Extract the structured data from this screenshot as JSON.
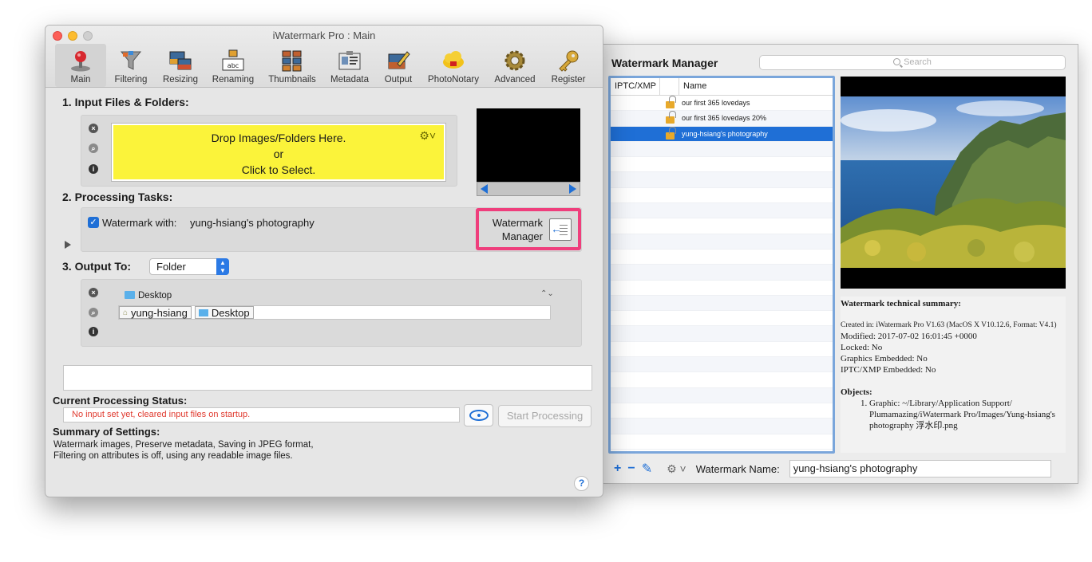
{
  "main_window": {
    "title": "iWatermark Pro : Main",
    "toolbar": [
      {
        "label": "Main",
        "icon": "joystick-icon",
        "active": true
      },
      {
        "label": "Filtering",
        "icon": "funnel-icon"
      },
      {
        "label": "Resizing",
        "icon": "resize-photos-icon"
      },
      {
        "label": "Renaming",
        "icon": "rename-abc-icon"
      },
      {
        "label": "Thumbnails",
        "icon": "thumbnails-icon"
      },
      {
        "label": "Metadata",
        "icon": "id-card-icon"
      },
      {
        "label": "Output",
        "icon": "output-pen-icon"
      },
      {
        "label": "PhotoNotary",
        "icon": "cloud-notary-icon"
      },
      {
        "label": "Advanced",
        "icon": "gear-icon"
      },
      {
        "label": "Register",
        "icon": "key-icon"
      }
    ],
    "input": {
      "title": "1. Input Files & Folders:",
      "drop_line1": "Drop Images/Folders Here.",
      "drop_line2": "or",
      "drop_line3": "Click to Select."
    },
    "tasks": {
      "title": "2. Processing Tasks:",
      "watermark_with_label": "Watermark with:",
      "watermark_with_checked": true,
      "watermark_value": "yung-hsiang's photography",
      "manager_line1": "Watermark",
      "manager_line2": "Manager"
    },
    "output": {
      "title": "3. Output To:",
      "selected": "Folder",
      "folder_name": "Desktop",
      "path": [
        "yung-hsiang",
        "Desktop"
      ]
    },
    "status": {
      "title": "Current Processing Status:",
      "message": "No input set yet, cleared input files on startup.",
      "start_button": "Start Processing"
    },
    "summary": {
      "title": "Summary of Settings:",
      "line1": "Watermark images, Preserve metadata, Saving in JPEG format,",
      "line2": "Filtering on attributes is off, using any readable image files."
    },
    "help_label": "?"
  },
  "watermark_manager": {
    "title": "Watermark Manager",
    "search_placeholder": "Search",
    "columns": [
      "IPTC/XMP",
      "Name"
    ],
    "rows": [
      {
        "name": "our first 365 lovedays",
        "selected": false
      },
      {
        "name": "our first 365 lovedays 20%",
        "selected": false
      },
      {
        "name": "yung-hsiang's photography",
        "selected": true
      }
    ],
    "tech_summary": {
      "heading": "Watermark technical summary:",
      "created": "Created in: iWatermark Pro V1.63 (MacOS X V10.12.6, Format: V4.1)",
      "modified": "Modified: 2017-07-02 16:01:45 +0000",
      "locked": "Locked: No",
      "graphics": "Graphics Embedded: No",
      "iptc": "IPTC/XMP Embedded: No",
      "objects_heading": "Objects:",
      "object1": "Graphic: ~/Library/Application Support/ Plumamazing/iWatermark Pro/Images/Yung-hsiang's photography 浮水印.png"
    },
    "watermark_name_label": "Watermark Name:",
    "watermark_name_value": "yung-hsiang's photography",
    "accent_color": "#1f6fd6",
    "highlight_color": "#ef3e7c"
  }
}
